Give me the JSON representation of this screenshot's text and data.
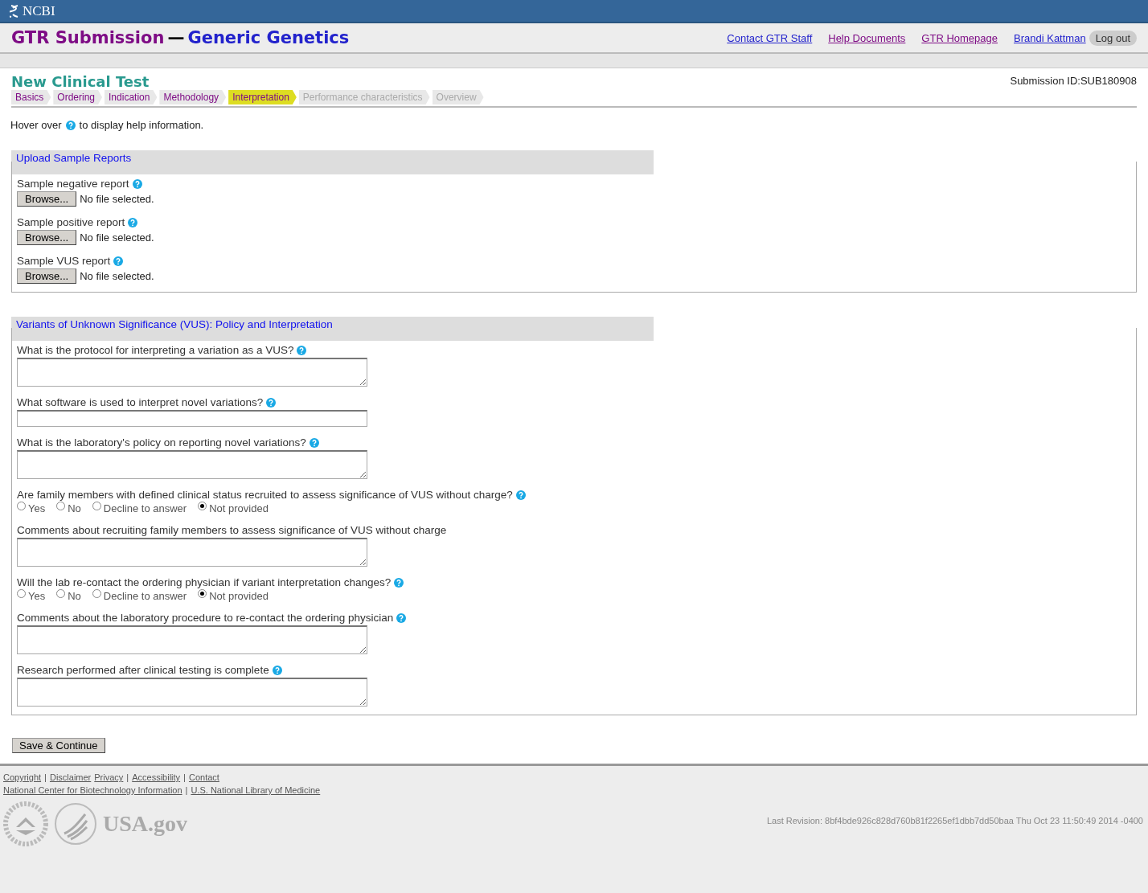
{
  "brand": "NCBI",
  "header": {
    "title": "GTR Submission",
    "separator": "—",
    "lab": "Generic Genetics",
    "links": [
      {
        "label": "Contact GTR Staff",
        "visited": false
      },
      {
        "label": "Help Documents",
        "visited": true
      },
      {
        "label": "GTR Homepage",
        "visited": true
      },
      {
        "label": "Brandi Kattman",
        "visited": false
      }
    ],
    "logout": "Log out"
  },
  "page_title": "New Clinical Test",
  "submission_id": "Submission ID:SUB180908",
  "steps": [
    {
      "label": "Basics",
      "selected": false,
      "disabled": false
    },
    {
      "label": "Ordering",
      "selected": false,
      "disabled": false
    },
    {
      "label": "Indication",
      "selected": false,
      "disabled": false
    },
    {
      "label": "Methodology",
      "selected": false,
      "disabled": false
    },
    {
      "label": "Interpretation",
      "selected": true,
      "disabled": false
    },
    {
      "label": "Performance characteristics",
      "selected": false,
      "disabled": true
    },
    {
      "label": "Overview",
      "selected": false,
      "disabled": true
    }
  ],
  "hint": {
    "before": "Hover over",
    "after": "to display help information."
  },
  "sections": [
    {
      "title": "Upload Sample Reports",
      "fields": [
        {
          "kind": "file",
          "label": "Sample negative report",
          "help": true,
          "button": "Browse...",
          "status": "No file selected."
        },
        {
          "kind": "file",
          "label": "Sample positive report",
          "help": true,
          "button": "Browse...",
          "status": "No file selected."
        },
        {
          "kind": "file",
          "label": "Sample VUS report",
          "help": true,
          "button": "Browse...",
          "status": "No file selected."
        }
      ]
    },
    {
      "title": "Variants of Unknown Significance (VUS): Policy and Interpretation",
      "fields": [
        {
          "kind": "textarea",
          "label": "What is the protocol for interpreting a variation as a VUS?",
          "help": true
        },
        {
          "kind": "input",
          "label": "What software is used to interpret novel variations?",
          "help": true
        },
        {
          "kind": "textarea",
          "label": "What is the laboratory's policy on reporting novel variations?",
          "help": true
        },
        {
          "kind": "radio",
          "label": "Are family members with defined clinical status recruited to assess significance of VUS without charge?",
          "help": true,
          "options": [
            {
              "label": "Yes",
              "selected": false
            },
            {
              "label": "No",
              "selected": false
            },
            {
              "label": "Decline to answer",
              "selected": false
            },
            {
              "label": "Not provided",
              "selected": true
            }
          ]
        },
        {
          "kind": "textarea",
          "label": "Comments about recruiting family members to assess significance of VUS without charge",
          "help": false
        },
        {
          "kind": "radio",
          "label": "Will the lab re-contact the ordering physician if variant interpretation changes?",
          "help": true,
          "options": [
            {
              "label": "Yes",
              "selected": false
            },
            {
              "label": "No",
              "selected": false
            },
            {
              "label": "Decline to answer",
              "selected": false
            },
            {
              "label": "Not provided",
              "selected": true
            }
          ]
        },
        {
          "kind": "textarea",
          "label": "Comments about the laboratory procedure to re-contact the ordering physician",
          "help": true
        },
        {
          "kind": "textarea",
          "label": "Research performed after clinical testing is complete",
          "help": true
        }
      ]
    }
  ],
  "save_button": "Save & Continue",
  "footer": {
    "links": [
      [
        {
          "kind": "link",
          "label": "Copyright"
        },
        {
          "kind": "divider",
          "label": "|"
        },
        {
          "kind": "link",
          "label": "Disclaimer"
        },
        {
          "kind": "link",
          "label": "Privacy"
        },
        {
          "kind": "divider",
          "label": "|"
        },
        {
          "kind": "link",
          "label": "Accessibility"
        },
        {
          "kind": "divider",
          "label": "|"
        },
        {
          "kind": "link",
          "label": "Contact"
        }
      ],
      [
        {
          "kind": "link",
          "label": "National Center for Biotechnology Information"
        },
        {
          "kind": "divider",
          "label": "|"
        },
        {
          "kind": "link",
          "label": "U.S. National Library of Medicine"
        }
      ]
    ],
    "usagov": "USA.gov",
    "revision": "Last Revision: 8bf4bde926c828d760b81f2265ef1dbb7dd50baa Thu Oct 23 11:50:49 2014 -0400"
  }
}
